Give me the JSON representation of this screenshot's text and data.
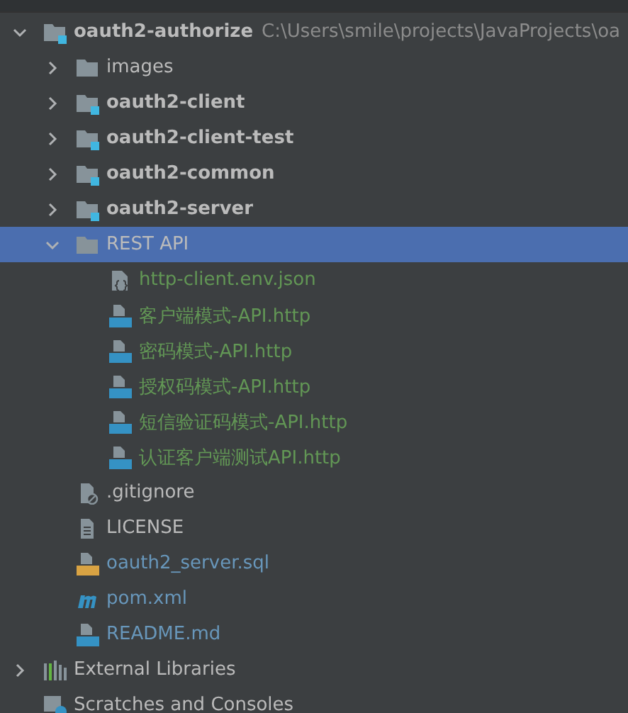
{
  "tree": [
    {
      "name": "oauth2-authorize",
      "kind": "module",
      "path": "C:\\Users\\smile\\projects\\JavaProjects\\oa",
      "expanded": true,
      "selected": false,
      "children": [
        {
          "name": "images",
          "kind": "folder",
          "expanded": false,
          "selected": false
        },
        {
          "name": "oauth2-client",
          "kind": "module",
          "expanded": false,
          "selected": false
        },
        {
          "name": "oauth2-client-test",
          "kind": "module",
          "expanded": false,
          "selected": false
        },
        {
          "name": "oauth2-common",
          "kind": "module",
          "expanded": false,
          "selected": false
        },
        {
          "name": "oauth2-server",
          "kind": "module",
          "expanded": false,
          "selected": false
        },
        {
          "name": "REST API",
          "kind": "folder",
          "expanded": true,
          "selected": true,
          "children": [
            {
              "name": "http-client.env.json",
              "kind": "json",
              "color": "#629755",
              "selected": false
            },
            {
              "name": "客户端模式-API.http",
              "kind": "api",
              "color": "#629755",
              "selected": false
            },
            {
              "name": "密码模式-API.http",
              "kind": "api",
              "color": "#629755",
              "selected": false
            },
            {
              "name": "授权码模式-API.http",
              "kind": "api",
              "color": "#629755",
              "selected": false
            },
            {
              "name": "短信验证码模式-API.http",
              "kind": "api",
              "color": "#629755",
              "selected": false
            },
            {
              "name": "认证客户端测试API.http",
              "kind": "api",
              "color": "#629755",
              "selected": false
            }
          ]
        },
        {
          "name": ".gitignore",
          "kind": "ignore",
          "color": "#bbbbbb",
          "selected": false
        },
        {
          "name": "LICENSE",
          "kind": "text",
          "color": "#bbbbbb",
          "selected": false
        },
        {
          "name": "oauth2_server.sql",
          "kind": "sql",
          "color": "#6897bb",
          "selected": false
        },
        {
          "name": "pom.xml",
          "kind": "maven",
          "color": "#6897bb",
          "selected": false
        },
        {
          "name": "README.md",
          "kind": "md",
          "color": "#6897bb",
          "selected": false
        }
      ]
    },
    {
      "name": "External Libraries",
      "kind": "libraries",
      "expanded": false,
      "selected": false
    },
    {
      "name": "Scratches and Consoles",
      "kind": "scratches",
      "selected": false
    }
  ]
}
